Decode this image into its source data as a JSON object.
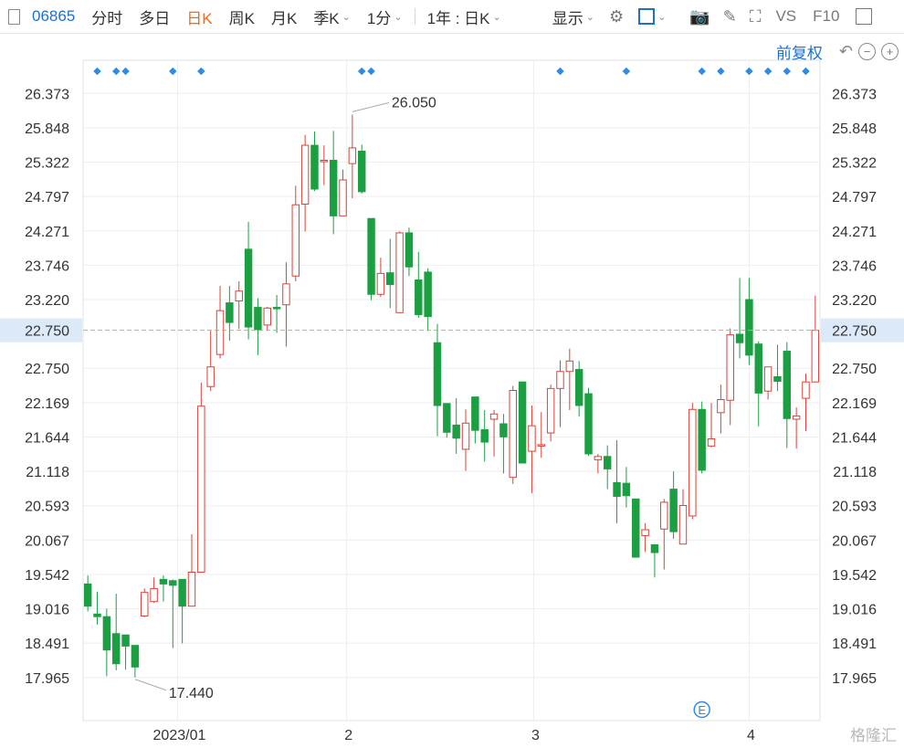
{
  "toolbar": {
    "stock_code": "06865",
    "tabs": [
      "分时",
      "多日",
      "日K",
      "周K",
      "月K",
      "季K"
    ],
    "active_tab": "日K",
    "interval": "1分",
    "range": "1年 : 日K",
    "display": "显示",
    "vs": "VS",
    "f10": "F10",
    "icons": [
      "gear-icon",
      "checkbox-icon",
      "camera-icon",
      "pencil-icon",
      "fullscreen-icon",
      "panel-icon"
    ]
  },
  "subbar": {
    "price_adjust": "前复权",
    "icons": [
      "undo-icon",
      "zoom-out-icon",
      "zoom-in-icon"
    ]
  },
  "watermark": "格隆汇",
  "chart_data": {
    "type": "candlestick",
    "y_ticks": [
      "26.373",
      "25.848",
      "25.322",
      "24.797",
      "24.271",
      "23.746",
      "23.220",
      "22.750",
      "22.169",
      "21.644",
      "21.118",
      "20.593",
      "20.067",
      "19.542",
      "19.016",
      "18.491",
      "17.965",
      "17.440"
    ],
    "y_tick_values": [
      26.373,
      25.848,
      25.322,
      24.797,
      24.271,
      23.746,
      23.22,
      22.169,
      21.644,
      21.118,
      20.593,
      20.067,
      19.542,
      19.016,
      18.491,
      17.965,
      17.44
    ],
    "ylim": [
      16.78,
      26.88
    ],
    "current_price": 22.75,
    "current_price_label": "22.750",
    "x_ticks": [
      {
        "label": "2023/01",
        "index": 9.5
      },
      {
        "label": "2",
        "index": 27.4
      },
      {
        "label": "3",
        "index": 47.2
      },
      {
        "label": "4",
        "index": 70.0
      }
    ],
    "annotations": [
      {
        "label": "26.050",
        "index": 28,
        "value": 26.05
      },
      {
        "label": "17.440",
        "index": 5,
        "value": 17.44
      }
    ],
    "event_dot_indices": [
      1,
      3,
      4,
      9,
      12,
      29,
      30,
      50,
      57,
      65,
      67,
      70,
      72,
      74,
      76
    ],
    "event_marker": {
      "label": "E",
      "index": 65
    },
    "candles": [
      {
        "o": 18.87,
        "h": 19.0,
        "l": 18.45,
        "c": 18.53
      },
      {
        "o": 18.41,
        "h": 18.75,
        "l": 18.25,
        "c": 18.37
      },
      {
        "o": 18.37,
        "h": 18.49,
        "l": 17.46,
        "c": 17.86
      },
      {
        "o": 18.11,
        "h": 18.72,
        "l": 17.55,
        "c": 17.65
      },
      {
        "o": 18.09,
        "h": 18.09,
        "l": 17.56,
        "c": 17.92
      },
      {
        "o": 17.93,
        "h": 17.93,
        "l": 17.44,
        "c": 17.6
      },
      {
        "o": 18.38,
        "h": 18.8,
        "l": 18.36,
        "c": 18.74
      },
      {
        "o": 18.6,
        "h": 18.97,
        "l": 18.58,
        "c": 18.8
      },
      {
        "o": 18.94,
        "h": 19.0,
        "l": 18.6,
        "c": 18.87
      },
      {
        "o": 18.92,
        "h": 18.94,
        "l": 17.89,
        "c": 18.85
      },
      {
        "o": 18.94,
        "h": 18.94,
        "l": 17.96,
        "c": 18.53
      },
      {
        "o": 18.53,
        "h": 19.63,
        "l": 18.53,
        "c": 19.05
      },
      {
        "o": 19.05,
        "h": 21.95,
        "l": 19.04,
        "c": 21.59
      },
      {
        "o": 21.89,
        "h": 22.74,
        "l": 21.82,
        "c": 22.19
      },
      {
        "o": 22.38,
        "h": 23.43,
        "l": 22.32,
        "c": 23.05
      },
      {
        "o": 23.17,
        "h": 23.43,
        "l": 22.59,
        "c": 22.87
      },
      {
        "o": 23.2,
        "h": 23.5,
        "l": 22.77,
        "c": 23.35
      },
      {
        "o": 23.99,
        "h": 24.41,
        "l": 22.61,
        "c": 22.8
      },
      {
        "o": 23.1,
        "h": 23.24,
        "l": 22.37,
        "c": 22.76
      },
      {
        "o": 22.83,
        "h": 23.11,
        "l": 22.75,
        "c": 23.09
      },
      {
        "o": 23.1,
        "h": 23.29,
        "l": 22.71,
        "c": 23.09
      },
      {
        "o": 23.14,
        "h": 23.79,
        "l": 22.5,
        "c": 23.46
      },
      {
        "o": 23.58,
        "h": 24.96,
        "l": 23.5,
        "c": 24.67
      },
      {
        "o": 24.68,
        "h": 25.74,
        "l": 24.26,
        "c": 25.58
      },
      {
        "o": 25.58,
        "h": 25.79,
        "l": 24.88,
        "c": 24.91
      },
      {
        "o": 25.35,
        "h": 25.58,
        "l": 24.97,
        "c": 25.35
      },
      {
        "o": 25.35,
        "h": 25.8,
        "l": 24.22,
        "c": 24.5
      },
      {
        "o": 24.5,
        "h": 25.21,
        "l": 24.5,
        "c": 25.05
      },
      {
        "o": 25.3,
        "h": 26.05,
        "l": 24.77,
        "c": 25.54
      },
      {
        "o": 25.49,
        "h": 25.59,
        "l": 24.84,
        "c": 24.87
      },
      {
        "o": 24.46,
        "h": 24.46,
        "l": 23.21,
        "c": 23.3
      },
      {
        "o": 23.3,
        "h": 23.86,
        "l": 23.26,
        "c": 23.62
      },
      {
        "o": 23.63,
        "h": 24.15,
        "l": 23.09,
        "c": 23.45
      },
      {
        "o": 23.02,
        "h": 24.26,
        "l": 23.02,
        "c": 24.24
      },
      {
        "o": 24.24,
        "h": 24.32,
        "l": 23.58,
        "c": 23.72
      },
      {
        "o": 23.52,
        "h": 23.95,
        "l": 22.94,
        "c": 22.99
      },
      {
        "o": 23.64,
        "h": 23.7,
        "l": 22.74,
        "c": 22.96
      },
      {
        "o": 22.56,
        "h": 22.85,
        "l": 21.13,
        "c": 21.6
      },
      {
        "o": 21.63,
        "h": 21.63,
        "l": 21.11,
        "c": 21.19
      },
      {
        "o": 21.3,
        "h": 21.71,
        "l": 20.86,
        "c": 21.1
      },
      {
        "o": 20.93,
        "h": 21.54,
        "l": 20.6,
        "c": 21.33
      },
      {
        "o": 21.73,
        "h": 21.73,
        "l": 21.02,
        "c": 21.22
      },
      {
        "o": 21.23,
        "h": 21.53,
        "l": 20.74,
        "c": 21.04
      },
      {
        "o": 21.39,
        "h": 21.53,
        "l": 20.82,
        "c": 21.47
      },
      {
        "o": 21.32,
        "h": 21.47,
        "l": 20.56,
        "c": 21.12
      },
      {
        "o": 20.5,
        "h": 21.9,
        "l": 20.4,
        "c": 21.83
      },
      {
        "o": 21.96,
        "h": 21.96,
        "l": 20.72,
        "c": 20.72
      },
      {
        "o": 20.9,
        "h": 21.6,
        "l": 20.26,
        "c": 21.29
      },
      {
        "o": 21.0,
        "h": 21.5,
        "l": 20.8,
        "c": 21.0
      },
      {
        "o": 21.18,
        "h": 21.92,
        "l": 21.05,
        "c": 21.86
      },
      {
        "o": 21.86,
        "h": 22.29,
        "l": 21.27,
        "c": 22.12
      },
      {
        "o": 22.12,
        "h": 22.47,
        "l": 21.53,
        "c": 22.28
      },
      {
        "o": 22.15,
        "h": 22.28,
        "l": 21.43,
        "c": 21.6
      },
      {
        "o": 21.78,
        "h": 21.87,
        "l": 20.83,
        "c": 20.86
      },
      {
        "o": 20.77,
        "h": 20.86,
        "l": 20.56,
        "c": 20.82
      },
      {
        "o": 20.82,
        "h": 20.99,
        "l": 20.32,
        "c": 20.63
      },
      {
        "o": 20.42,
        "h": 21.07,
        "l": 19.8,
        "c": 20.21
      },
      {
        "o": 20.41,
        "h": 20.66,
        "l": 20.04,
        "c": 20.22
      },
      {
        "o": 20.17,
        "h": 20.17,
        "l": 19.28,
        "c": 19.28
      },
      {
        "o": 19.61,
        "h": 19.8,
        "l": 19.36,
        "c": 19.7
      },
      {
        "o": 19.47,
        "h": 19.47,
        "l": 18.97,
        "c": 19.35
      },
      {
        "o": 19.71,
        "h": 20.17,
        "l": 19.09,
        "c": 20.12
      },
      {
        "o": 20.32,
        "h": 20.59,
        "l": 19.56,
        "c": 19.67
      },
      {
        "o": 19.48,
        "h": 20.32,
        "l": 19.48,
        "c": 20.07
      },
      {
        "o": 19.91,
        "h": 21.64,
        "l": 19.86,
        "c": 21.54
      },
      {
        "o": 21.54,
        "h": 21.66,
        "l": 20.56,
        "c": 20.61
      },
      {
        "o": 20.98,
        "h": 21.64,
        "l": 20.96,
        "c": 21.09
      },
      {
        "o": 21.49,
        "h": 21.92,
        "l": 21.17,
        "c": 21.69
      },
      {
        "o": 21.68,
        "h": 22.78,
        "l": 21.3,
        "c": 22.68
      },
      {
        "o": 22.69,
        "h": 23.55,
        "l": 22.32,
        "c": 22.56
      },
      {
        "o": 23.22,
        "h": 23.55,
        "l": 22.22,
        "c": 22.37
      },
      {
        "o": 22.54,
        "h": 22.58,
        "l": 21.28,
        "c": 21.79
      },
      {
        "o": 21.82,
        "h": 22.1,
        "l": 21.69,
        "c": 22.19
      },
      {
        "o": 22.04,
        "h": 22.53,
        "l": 21.82,
        "c": 21.97
      },
      {
        "o": 22.43,
        "h": 22.57,
        "l": 20.95,
        "c": 21.4
      },
      {
        "o": 21.39,
        "h": 21.57,
        "l": 20.94,
        "c": 21.44
      },
      {
        "o": 21.71,
        "h": 22.09,
        "l": 21.21,
        "c": 21.96
      },
      {
        "o": 21.96,
        "h": 23.28,
        "l": 21.96,
        "c": 22.75
      }
    ]
  }
}
